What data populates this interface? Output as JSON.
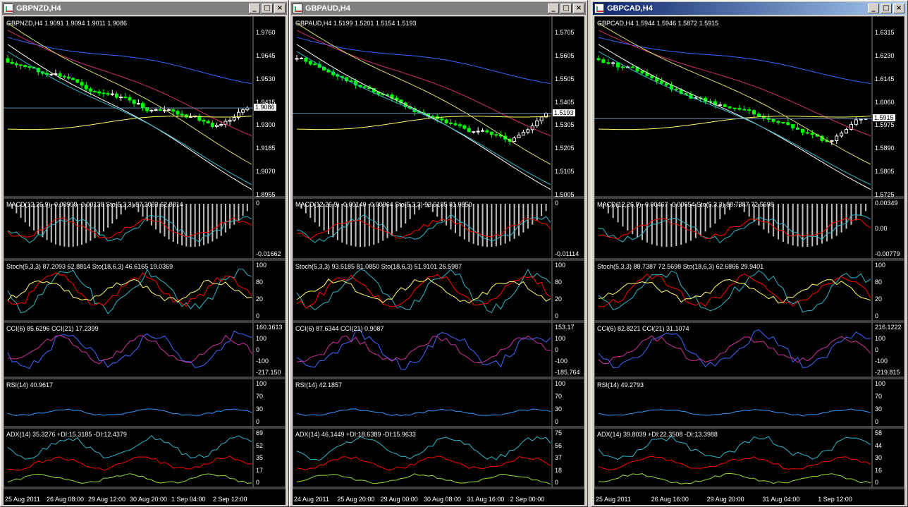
{
  "windows": [
    {
      "title": "GBPNZD,H4",
      "active": false,
      "price_header": "GBPNZD,H4  1.9091 1.9094 1.9011 1.9086",
      "price_axis": [
        "1.9760",
        "1.9645",
        "1.9530",
        "1.9415",
        "1.9300",
        "1.9185",
        "1.9070",
        "1.8955"
      ],
      "current_price": "1.9086",
      "macd_header": "MACD(12,26,9) -0.00908 -0.00138  Sto(5,3,3) 87.2093 62.8814",
      "macd_axis": [
        "0",
        "-0.01662"
      ],
      "stoch_header": "Stoch(5,3,3) 87.2093 62.8814  Sto(18,6,3) 46.6165 19.0369",
      "stoch_axis": [
        "100",
        "80",
        "20",
        "0"
      ],
      "cci_header": "CCI(6) 85.6296  CCI(21) 17.2399",
      "cci_axis": [
        "160.1613",
        "100",
        "0",
        "-100",
        "-217.150"
      ],
      "rsi_header": "RSI(14) 40.9617",
      "rsi_axis": [
        "100",
        "70",
        "30",
        "0"
      ],
      "adx_header": "ADX(14) 35.3276  +DI:15.3185  -DI:12.4379",
      "adx_axis": [
        "69",
        "52",
        "35",
        "17",
        "0"
      ],
      "dates": [
        "25 Aug 2011",
        "26 Aug 08:00",
        "29 Aug 12:00",
        "30 Aug 20:00",
        "1 Sep 04:00",
        "2 Sep 12:00"
      ]
    },
    {
      "title": "GBPAUD,H4",
      "active": false,
      "price_header": "GBPAUD,H4  1.5199 1.5201 1.5154 1.5193",
      "price_axis": [
        "1.5705",
        "1.5605",
        "1.5505",
        "1.5405",
        "1.5305",
        "1.5205",
        "1.5105",
        "1.5005"
      ],
      "current_price": "1.5193",
      "macd_header": "MACD(12,26,9) -0.00140 -0.00964  Sto(5,3,3) 93.5185 81.0850",
      "macd_axis": [
        "0",
        "-0.01114"
      ],
      "stoch_header": "Stoch(5,3,3) 93.5185 81.0850  Sto(18,6,3) 51.9101 26.5987",
      "stoch_axis": [
        "100",
        "80",
        "20",
        "0"
      ],
      "cci_header": "CCI(6) 87.6344  CCI(21) 0.9087",
      "cci_axis": [
        "153.17",
        "100",
        "0",
        "-100",
        "-185.764"
      ],
      "rsi_header": "RSI(14) 42.1857",
      "rsi_axis": [
        "100",
        "70",
        "30",
        "0"
      ],
      "adx_header": "ADX(14) 46.1449  +DI:18.6389  -DI:15.9633",
      "adx_axis": [
        "75",
        "56",
        "37",
        "18",
        "0"
      ],
      "dates": [
        "24 Aug 2011",
        "25 Aug 20:00",
        "29 Aug 00:00",
        "30 Aug 08:00",
        "31 Aug 16:00",
        "2 Sep 00:00"
      ]
    },
    {
      "title": "GBPCAD,H4",
      "active": true,
      "price_header": "GBPCAD,H4  1.5944 1.5946 1.5872 1.5915",
      "price_axis": [
        "1.6315",
        "1.6230",
        "1.6145",
        "1.6060",
        "1.5975",
        "1.5890",
        "1.5805",
        "1.5725"
      ],
      "current_price": "1.5915",
      "macd_header": "MACD(12,26,9) -0.00467 -0.00654  Sto(5,3,3) 88.7387 72.5698",
      "macd_axis": [
        "0.00349",
        "0.00",
        "-0.00779"
      ],
      "stoch_header": "Stoch(5,3,3) 88.7387 72.5698  Sto(18,6,3) 62.6866 29.9401",
      "stoch_axis": [
        "100",
        "80",
        "20",
        "0"
      ],
      "cci_header": "CCI(6) 82.8221  CCI(21) 31.1074",
      "cci_axis": [
        "216.1222",
        "100",
        "0",
        "-100",
        "-219.815"
      ],
      "rsi_header": "RSI(14) 49.2793",
      "rsi_axis": [
        "100",
        "70",
        "30",
        "0"
      ],
      "adx_header": "ADX(14) 39.8039  +DI:22.3508  -DI:13.3988",
      "adx_axis": [
        "58",
        "44",
        "30",
        "16",
        "0"
      ],
      "dates": [
        "25 Aug 2011",
        "26 Aug 16:00",
        "29 Aug 20:00",
        "31 Aug 04:00",
        "1 Sep 12:00"
      ]
    }
  ],
  "colors": {
    "background": "#000000",
    "bull_candle": "#ffffff",
    "bear_candle": "#00ff00",
    "macd_hist": "#c0c0c0",
    "signal_red": "#ff0000",
    "line_cyan": "#2fb8c8",
    "ma_yellow": "#ffff66",
    "ma_blue": "#3366ff",
    "ma_magenta": "#d0306a"
  }
}
